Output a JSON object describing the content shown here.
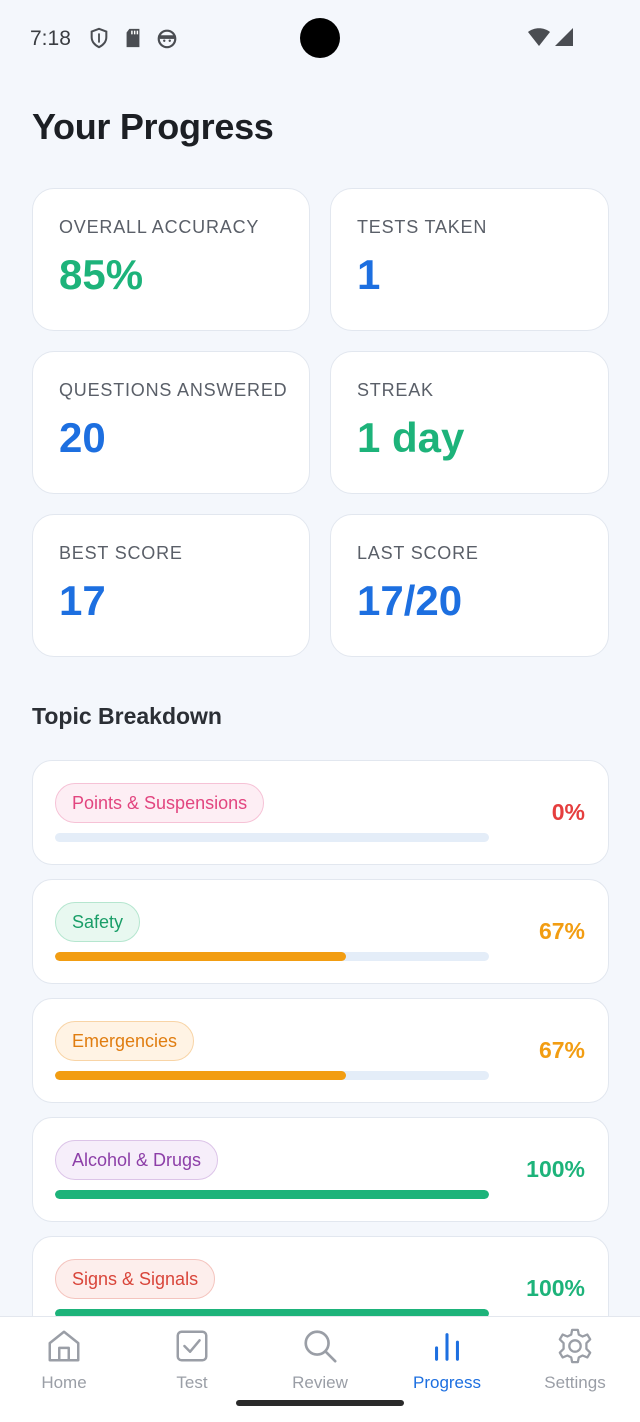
{
  "status_bar": {
    "time": "7:18",
    "left_icons": [
      "shield-icon",
      "sd-card-icon",
      "android-face-icon"
    ],
    "right_icons": [
      "wifi-icon",
      "cell-signal-icon"
    ]
  },
  "page": {
    "title": "Your Progress"
  },
  "stats": [
    {
      "label": "OVERALL ACCURACY",
      "value": "85%",
      "color": "#1db37a"
    },
    {
      "label": "TESTS TAKEN",
      "value": "1",
      "color": "#1d6fe0"
    },
    {
      "label": "QUESTIONS ANSWERED",
      "value": "20",
      "color": "#1d6fe0"
    },
    {
      "label": "STREAK",
      "value": "1 day",
      "color": "#1db37a"
    },
    {
      "label": "BEST SCORE",
      "value": "17",
      "color": "#1d6fe0"
    },
    {
      "label": "LAST SCORE",
      "value": "17/20",
      "color": "#1d6fe0"
    }
  ],
  "topics_section": {
    "title": "Topic Breakdown"
  },
  "topics": [
    {
      "name": "Points & Suspensions",
      "percent_label": "0%",
      "progress": 0,
      "pill_text": "#e2457f",
      "pill_bg": "#fdeef4",
      "pill_border": "#f6c2d6",
      "bar_color": "#e53e3e",
      "pct_color": "#e53e3e"
    },
    {
      "name": "Safety",
      "percent_label": "67%",
      "progress": 0.67,
      "pill_text": "#1a9e68",
      "pill_bg": "#e8f8f0",
      "pill_border": "#b5e6cf",
      "bar_color": "#f29d12",
      "pct_color": "#f29d12"
    },
    {
      "name": "Emergencies",
      "percent_label": "67%",
      "progress": 0.67,
      "pill_text": "#e07d10",
      "pill_bg": "#fff3e4",
      "pill_border": "#f8d4a6",
      "bar_color": "#f29d12",
      "pct_color": "#f29d12"
    },
    {
      "name": "Alcohol & Drugs",
      "percent_label": "100%",
      "progress": 1,
      "pill_text": "#8d3fa8",
      "pill_bg": "#f6eefa",
      "pill_border": "#dcc4e8",
      "bar_color": "#1db37a",
      "pct_color": "#1db37a"
    },
    {
      "name": "Signs & Signals",
      "percent_label": "100%",
      "progress": 1,
      "pill_text": "#d9453a",
      "pill_bg": "#fdeeec",
      "pill_border": "#f4c4be",
      "bar_color": "#1db37a",
      "pct_color": "#1db37a"
    }
  ],
  "nav": {
    "active_color": "#1d6fe0",
    "inactive_color": "#9a9ea6",
    "items": [
      {
        "label": "Home",
        "icon": "home-icon",
        "active": false
      },
      {
        "label": "Test",
        "icon": "checkbox-icon",
        "active": false
      },
      {
        "label": "Review",
        "icon": "search-icon",
        "active": false
      },
      {
        "label": "Progress",
        "icon": "bar-chart-icon",
        "active": true
      },
      {
        "label": "Settings",
        "icon": "gear-icon",
        "active": false
      }
    ]
  }
}
